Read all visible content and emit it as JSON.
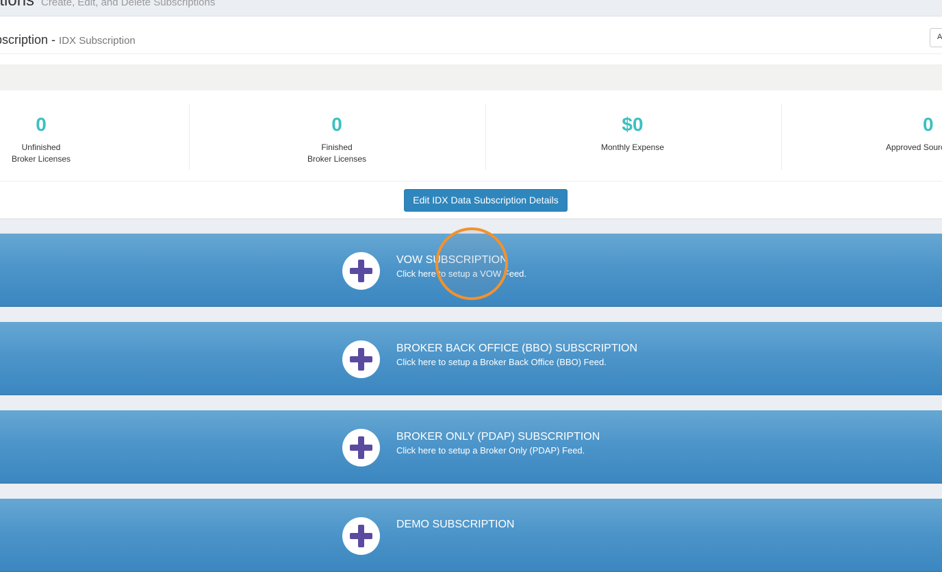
{
  "page_header": {
    "title": "ptions",
    "subtitle": "Create, Edit, and Delete Subscriptions"
  },
  "panel": {
    "title": "bscription - ",
    "title_muted": "IDX Subscription",
    "heading_button_label": "A"
  },
  "stats": [
    {
      "value": "0",
      "line1": "Unfinished",
      "line2": "Broker Licenses"
    },
    {
      "value": "0",
      "line1": "Finished",
      "line2": "Broker Licenses"
    },
    {
      "value": "$0",
      "line1": "Monthly Expense",
      "line2": ""
    },
    {
      "value": "0",
      "line1": "Approved Sourc",
      "line2": ""
    }
  ],
  "edit_button_label": "Edit IDX Data Subscription Details",
  "subscriptions": [
    {
      "title": "VOW SUBSCRIPTION",
      "description": "Click here to setup a VOW Feed."
    },
    {
      "title": "BROKER BACK OFFICE (BBO) SUBSCRIPTION",
      "description": "Click here to setup a Broker Back Office (BBO) Feed."
    },
    {
      "title": "BROKER ONLY (PDAP) SUBSCRIPTION",
      "description": "Click here to setup a Broker Only (PDAP) Feed."
    },
    {
      "title": "DEMO SUBSCRIPTION",
      "description": ""
    }
  ],
  "colors": {
    "accent_teal": "#3cc0c0",
    "button_blue": "#2f86bd",
    "bar_blue": "#4b94c9",
    "plus_purple": "#5a4ba0",
    "click_ring_orange": "#f2922e"
  },
  "icons": {
    "subscription_add": "plus-icon"
  }
}
